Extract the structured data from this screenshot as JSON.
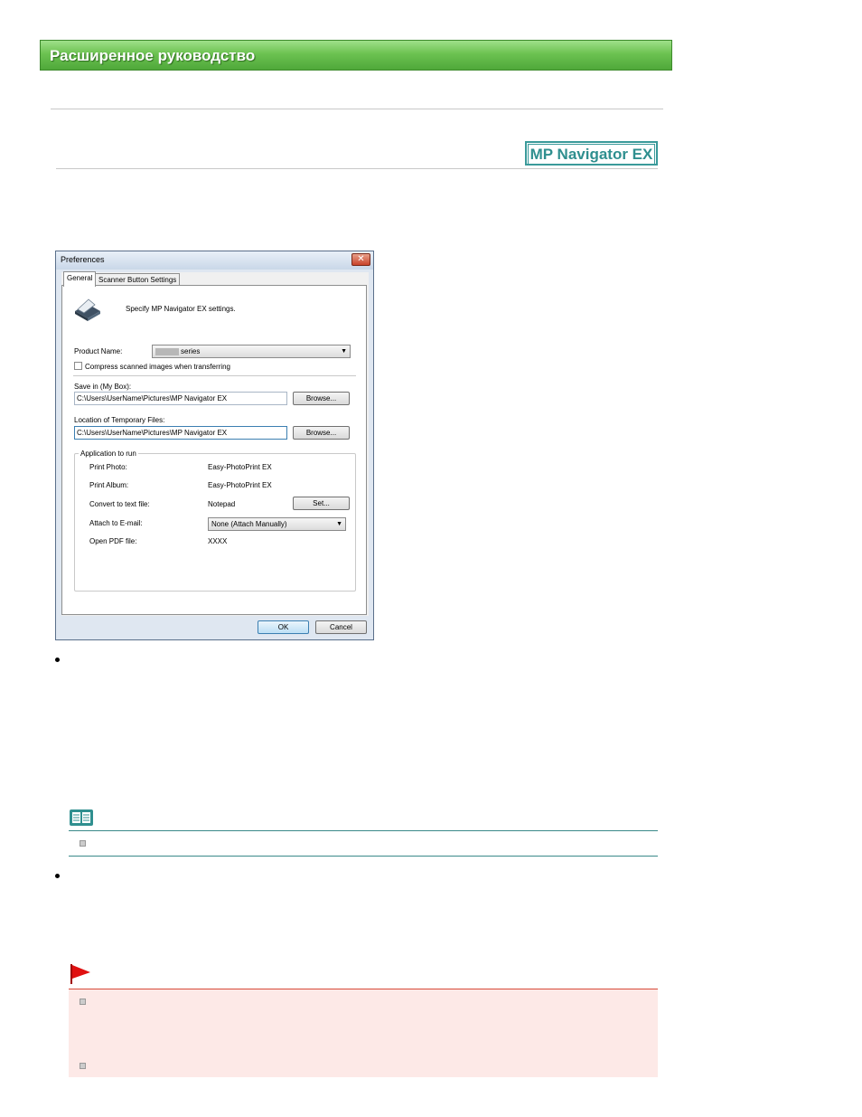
{
  "header": {
    "title": "Расширенное руководство"
  },
  "logo": {
    "text": "MP Navigator EX"
  },
  "dialog": {
    "title": "Preferences",
    "close": "✕",
    "tabs": [
      {
        "label": "General",
        "active": true
      },
      {
        "label": "Scanner Button Settings",
        "active": false
      }
    ],
    "intro": "Specify MP Navigator EX settings.",
    "product_name_label": "Product Name:",
    "product_name_value": "series",
    "compress_label": "Compress scanned images when transferring",
    "save_in_label": "Save in (My Box):",
    "save_in_value": "C:\\Users\\UserName\\Pictures\\MP Navigator EX",
    "temp_label": "Location of Temporary Files:",
    "temp_value": "C:\\Users\\UserName\\Pictures\\MP Navigator EX",
    "browse": "Browse...",
    "app_group_title": "Application to run",
    "apps": [
      {
        "label": "Print Photo:",
        "value": "Easy-PhotoPrint EX"
      },
      {
        "label": "Print Album:",
        "value": "Easy-PhotoPrint EX"
      },
      {
        "label": "Convert to text file:",
        "value": "Notepad"
      },
      {
        "label": "Attach to E-mail:",
        "value": "None (Attach Manually)"
      },
      {
        "label": "Open PDF file:",
        "value": "XXXX"
      }
    ],
    "set_button": "Set...",
    "ok": "OK",
    "cancel": "Cancel"
  },
  "colors": {
    "banner": "#6cc251",
    "logo": "#2f8f8f",
    "note_line": "#3a8a8a",
    "important_bg": "#fde9e7",
    "important_flag": "#e01010"
  },
  "icons": [
    "scanner-icon",
    "note-book-icon",
    "important-flag-icon"
  ]
}
